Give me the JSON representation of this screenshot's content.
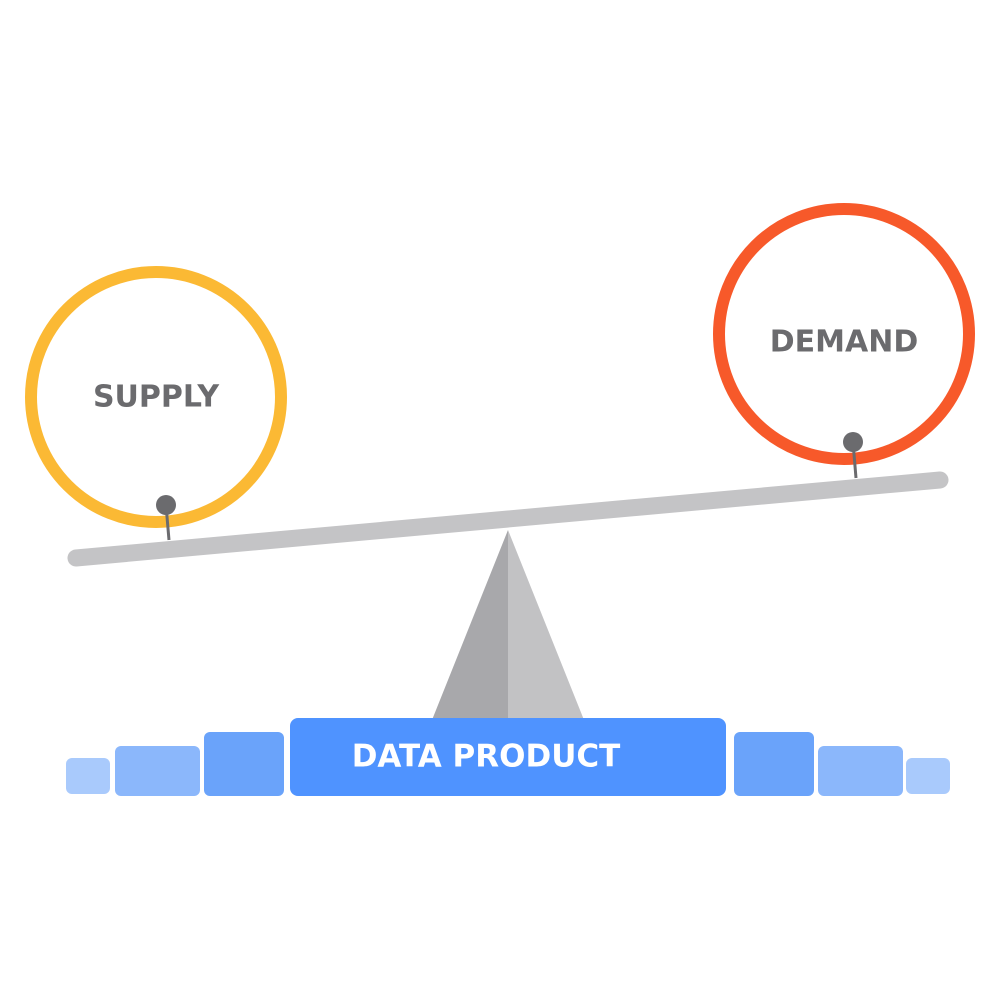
{
  "labels": {
    "supply": "SUPPLY",
    "demand": "DEMAND",
    "product": "DATA PRODUCT"
  },
  "colors": {
    "supply_ring": "#FBB934",
    "demand_ring": "#F7592A",
    "beam": "#C4C4C6",
    "pin": "#6B6B6E",
    "fulcrum_light": "#C2C2C4",
    "fulcrum_dark": "#A8A8AB",
    "label_text": "#6B6B6E",
    "product_fill": "#4F93FF",
    "product_text": "#FFFFFF",
    "segment_mid": "#6AA3FA",
    "segment_light": "#8BB7FB",
    "segment_pale": "#A9CAFC"
  }
}
